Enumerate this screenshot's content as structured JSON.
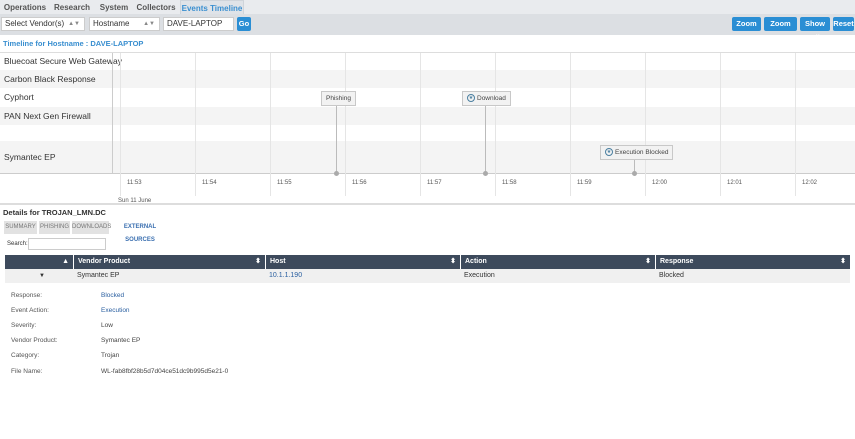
{
  "nav": {
    "tabs": [
      "Operations",
      "Research",
      "System",
      "Collectors",
      "Events Timeline"
    ],
    "active": "Events Timeline"
  },
  "toolbar": {
    "vendor_select": "Select Vendor(s)",
    "field_select": "Hostname",
    "hostname_value": "DAVE-LAPTOP",
    "go": "Go",
    "zoom_in": "Zoom In",
    "zoom_out": "Zoom Out",
    "show_all": "Show All",
    "reset": "Reset"
  },
  "timeline": {
    "title": "Timeline for Hostname : DAVE-LAPTOP",
    "rows": [
      "Bluecoat Secure Web Gateway",
      "Carbon Black Response",
      "Cyphort",
      "PAN Next Gen Firewall",
      "",
      "Symantec EP"
    ],
    "ticks": [
      "11:53",
      "11:54",
      "11:55",
      "11:56",
      "11:57",
      "11:58",
      "11:59",
      "12:00",
      "12:01",
      "12:02"
    ],
    "date": "Sun 11 June",
    "events": [
      {
        "label": "Phishing",
        "row": "Cyphort",
        "icon": false
      },
      {
        "label": "Download",
        "row": "Cyphort",
        "icon": true
      },
      {
        "label": "Execution Blocked",
        "row": "Symantec EP",
        "icon": true
      }
    ]
  },
  "details": {
    "title": "Details for TROJAN_LMN.DC",
    "tabs": [
      "SUMMARY",
      "PHISHING",
      "DOWNLOADS",
      "EXTERNAL SOURCES"
    ],
    "active_tab": "EXTERNAL SOURCES",
    "search_label": "Search:",
    "search_value": "",
    "columns": [
      "",
      "Vendor Product",
      "Host",
      "Action",
      "Response"
    ],
    "row": {
      "vendor": "Symantec EP",
      "host": "10.1.1.190",
      "action": "Execution",
      "response": "Blocked"
    },
    "fields": [
      {
        "label": "Response:",
        "value": "Blocked"
      },
      {
        "label": "Event Action:",
        "value": "Execution"
      },
      {
        "label": "Severity:",
        "value": "Low"
      },
      {
        "label": "Vendor Product:",
        "value": "Symantec EP"
      },
      {
        "label": "Category:",
        "value": "Trojan"
      },
      {
        "label": "File Name:",
        "value": "WL-fab8fbf28b5d7d04ce51dc9b995d5e21-0"
      }
    ]
  },
  "colors": {
    "accent": "#2a8ed4",
    "header": "#3d4a5c"
  }
}
